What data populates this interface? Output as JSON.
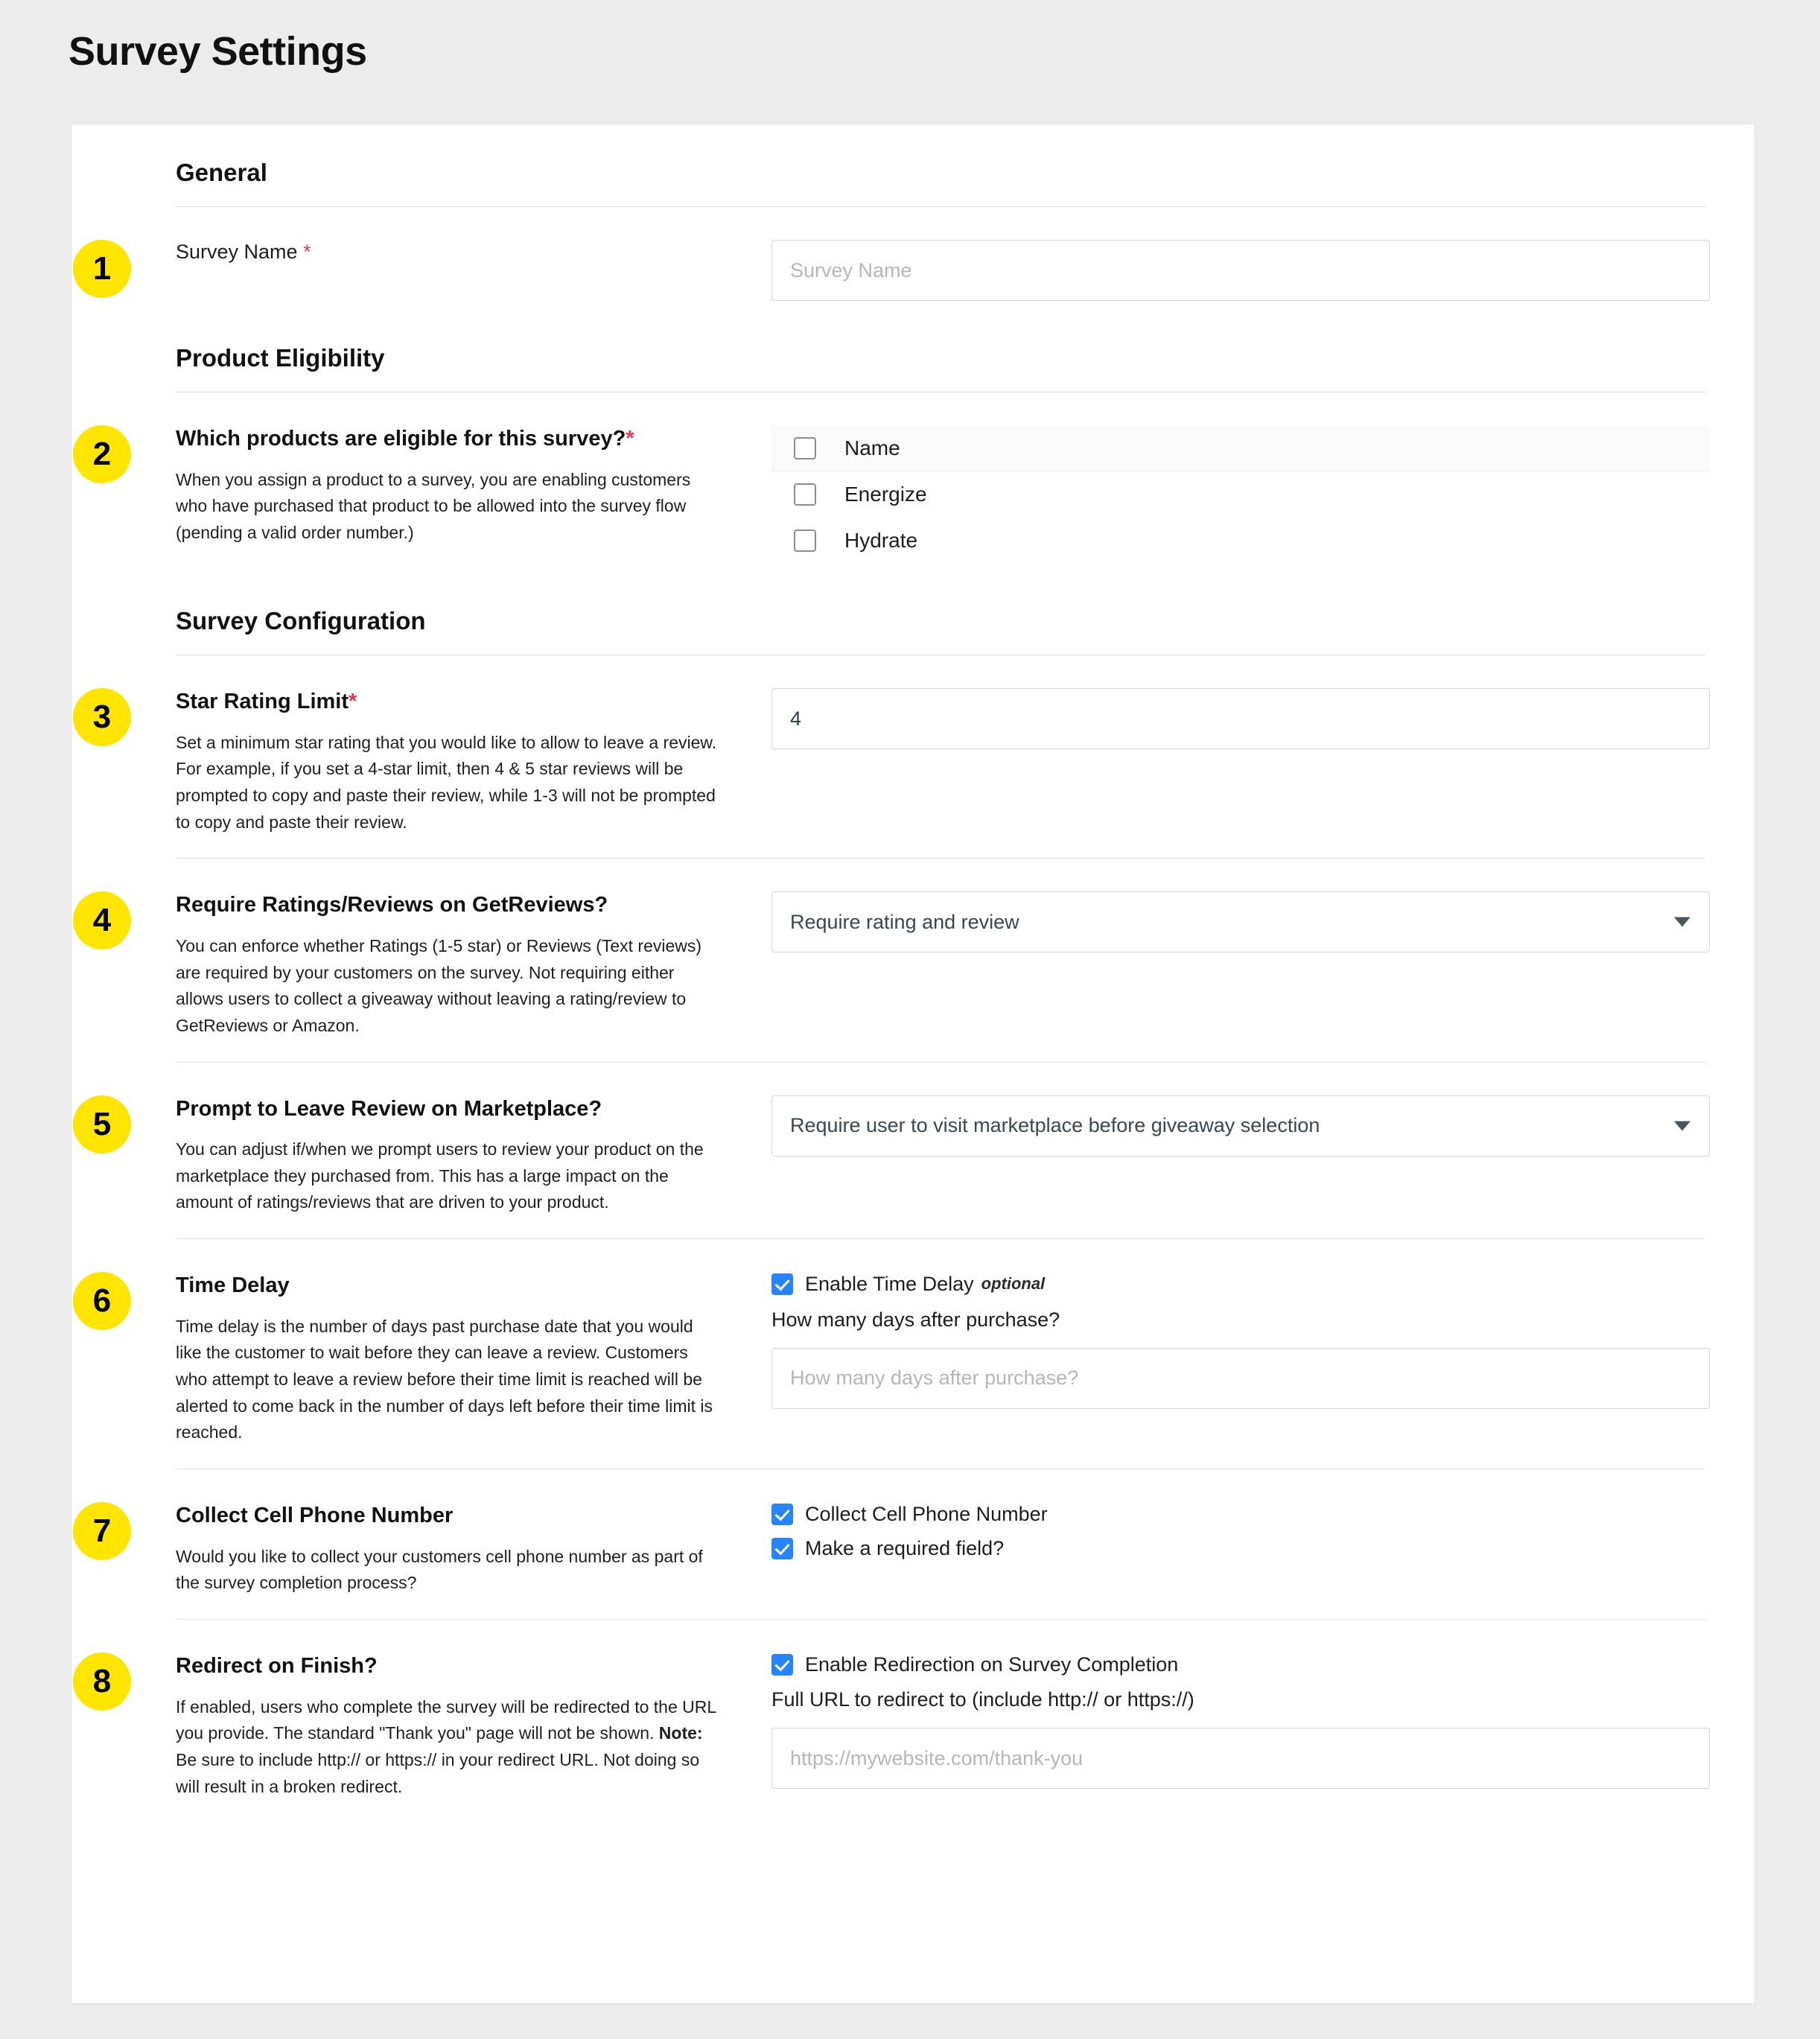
{
  "page": {
    "title": "Survey Settings"
  },
  "groups": {
    "general": "General",
    "product_eligibility": "Product Eligibility",
    "survey_configuration": "Survey Configuration"
  },
  "badges": {
    "b1": "1",
    "b2": "2",
    "b3": "3",
    "b4": "4",
    "b5": "5",
    "b6": "6",
    "b7": "7",
    "b8": "8"
  },
  "survey_name": {
    "label": "Survey Name",
    "required_mark": "*",
    "placeholder": "Survey Name",
    "value": ""
  },
  "product_eligibility": {
    "label": "Which products are eligible for this survey?",
    "required_mark": "*",
    "help": "When you assign a product to a survey, you are enabling customers who have purchased that product to be allowed into the survey flow (pending a valid order number.)",
    "column_header": "Name",
    "products": [
      {
        "name": "Energize",
        "checked": false
      },
      {
        "name": "Hydrate",
        "checked": false
      }
    ]
  },
  "star_rating": {
    "label": "Star Rating Limit",
    "required_mark": "*",
    "help": "Set a minimum star rating that you would like to allow to leave a review. For example, if you set a 4-star limit, then 4 & 5 star reviews will be prompted to copy and paste their review, while 1-3 will not be prompted to copy and paste their review.",
    "value": "4"
  },
  "require_ratings": {
    "label": "Require Ratings/Reviews on GetReviews?",
    "help": "You can enforce whether Ratings (1-5 star) or Reviews (Text reviews) are required by your customers on the survey. Not requiring either allows users to collect a giveaway without leaving a rating/review to GetReviews or Amazon.",
    "selected": "Require rating and review"
  },
  "prompt_review": {
    "label": "Prompt to Leave Review on Marketplace?",
    "help": "You can adjust if/when we prompt users to review your product on the marketplace they purchased from. This has a large impact on the amount of ratings/reviews that are driven to your product.",
    "selected": "Require user to visit marketplace before giveaway selection"
  },
  "time_delay": {
    "label": "Time Delay",
    "help": "Time delay is the number of days past purchase date that you would like the customer to wait before they can leave a review. Customers who attempt to leave a review before their time limit is reached will be alerted to come back in the number of days left before their time limit is reached.",
    "enable_label": "Enable Time Delay",
    "optional_tag": "optional",
    "enabled": true,
    "question": "How many days after purchase?",
    "placeholder": "How many days after purchase?",
    "value": ""
  },
  "cell_phone": {
    "label": "Collect Cell Phone Number",
    "help": "Would you like to collect your customers cell phone number as part of the survey completion process?",
    "collect_label": "Collect Cell Phone Number",
    "collect_checked": true,
    "required_label": "Make a required field?",
    "required_checked": true
  },
  "redirect": {
    "label": "Redirect on Finish?",
    "help_line1": "If enabled, users who complete the survey will be redirected to the URL you provide. The standard \"Thank you\" page will not be shown.",
    "note_prefix": "Note:",
    "help_line2": " Be sure to include http:// or https:// in your redirect URL. Not doing so will result in a broken redirect.",
    "enable_label": "Enable Redirection on Survey Completion",
    "enabled": true,
    "url_question": "Full URL to redirect to (include http:// or https://)",
    "placeholder": "https://mywebsite.com/thank-you",
    "value": ""
  },
  "colors": {
    "badge_bg": "#ffe500",
    "checkbox_blue": "#2684ff",
    "required_red": "#e8384f",
    "page_bg": "#ececec",
    "card_bg": "#ffffff"
  }
}
